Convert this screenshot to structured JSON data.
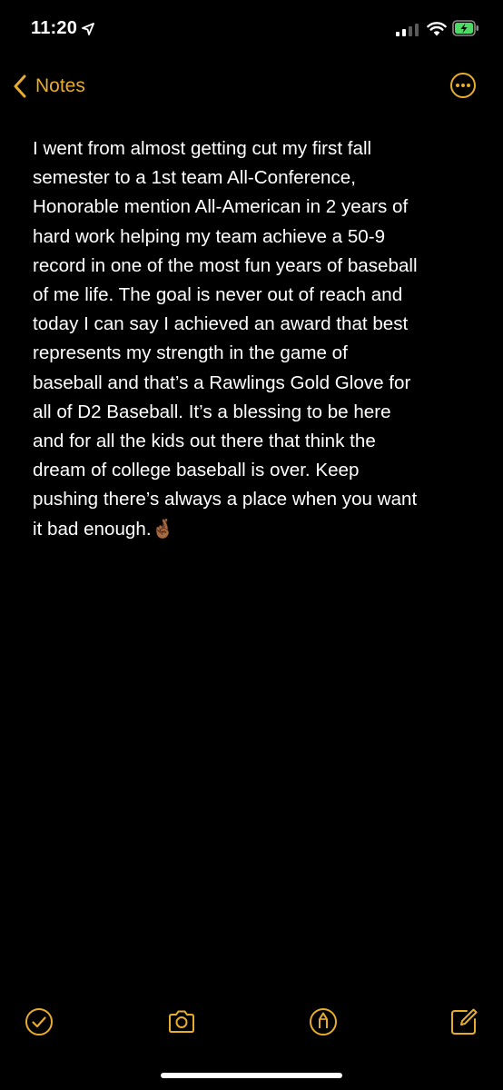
{
  "status_bar": {
    "time": "11:20",
    "location_icon": "location-arrow-icon",
    "signal_icon": "cellular-signal-icon",
    "wifi_icon": "wifi-icon",
    "battery_icon": "battery-charging-icon"
  },
  "nav": {
    "back_label": "Notes",
    "back_icon": "chevron-left-icon",
    "more_icon": "ellipsis-circle-icon"
  },
  "note": {
    "lines": [
      "I went from almost getting cut my first fall",
      "semester to a 1st team All-Conference,",
      "Honorable mention All-American in 2 years of",
      "hard work helping my team achieve a 50-9",
      "record in one of the most fun years of baseball",
      "of me life. The goal is never out of reach and",
      "today I can say I achieved an award that best",
      "represents my strength in the game of",
      "baseball and that’s a Rawlings Gold Glove for",
      "all of D2 Baseball. It’s a blessing to be here",
      "and for all the kids out there that think the",
      "dream of college baseball is over. Keep",
      "pushing there’s always a place when you want",
      "it bad enough.🤞🏾"
    ]
  },
  "toolbar": {
    "checklist_icon": "checkmark-circle-icon",
    "camera_icon": "camera-icon",
    "markup_icon": "markup-pen-icon",
    "compose_icon": "compose-icon"
  },
  "colors": {
    "background": "#000000",
    "accent": "#e8ac2c",
    "text": "#ffffff"
  }
}
